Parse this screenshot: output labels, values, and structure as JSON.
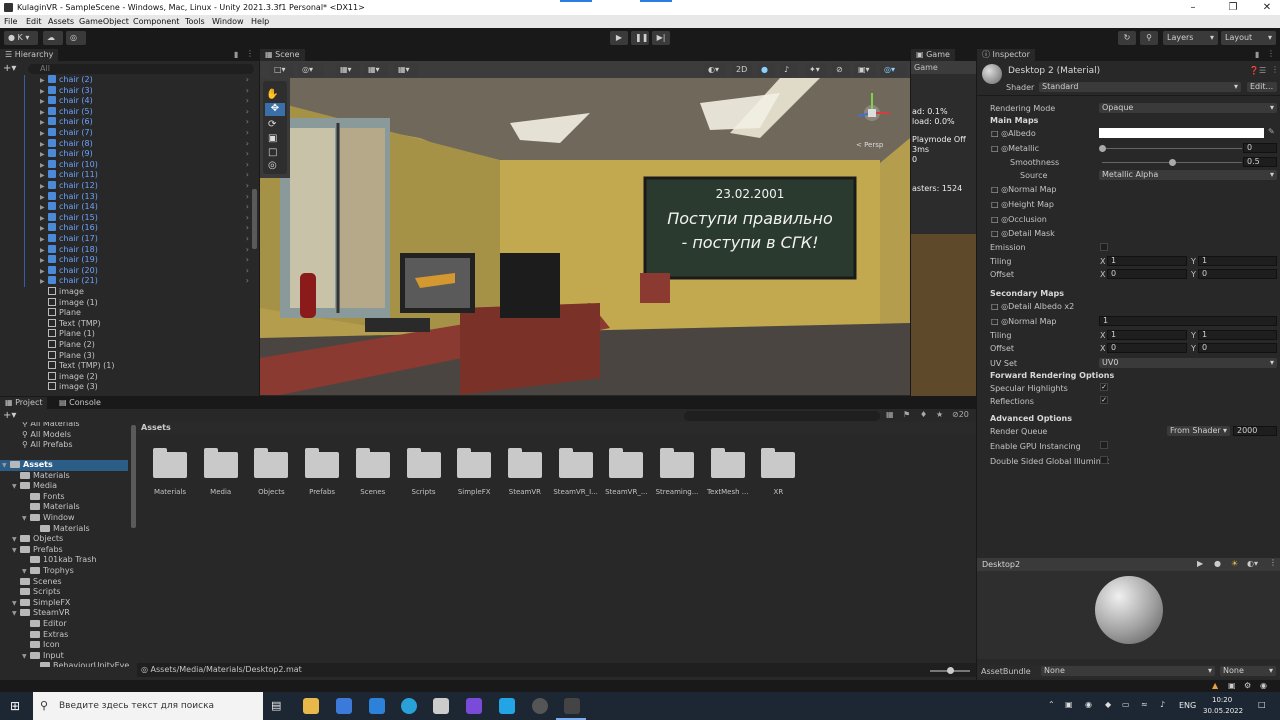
{
  "window": {
    "title": "KulaginVR - SampleScene - Windows, Mac, Linux - Unity 2021.3.3f1 Personal* <DX11>"
  },
  "menu": [
    "File",
    "Edit",
    "Assets",
    "GameObject",
    "Component",
    "Tools",
    "Window",
    "Help"
  ],
  "toolbar": {
    "account": "K",
    "layers": "Layers",
    "layout": "Layout"
  },
  "hierarchy": {
    "tab": "Hierarchy",
    "search_placeholder": "All",
    "chairs": [
      "chair (2)",
      "chair (3)",
      "chair (4)",
      "chair (5)",
      "chair (6)",
      "chair (7)",
      "chair (8)",
      "chair (9)",
      "chair (10)",
      "chair (11)",
      "chair (12)",
      "chair (13)",
      "chair (14)",
      "chair (15)",
      "chair (16)",
      "chair (17)",
      "chair (18)",
      "chair (19)",
      "chair (20)",
      "chair (21)"
    ],
    "others": [
      "image",
      "image (1)",
      "Plane",
      "Text (TMP)",
      "Plane (1)",
      "Plane (2)",
      "Plane (3)",
      "Text (TMP) (1)",
      "image (2)",
      "image (3)"
    ]
  },
  "scene": {
    "tab": "Scene",
    "mode_2d": "2D",
    "persp": "< Persp",
    "board_date": "23.02.2001",
    "board_line1": "Поступи правильно",
    "board_line2": "- поступи в СГК!"
  },
  "game": {
    "tab": "Game",
    "dropdown": "Game",
    "stats": [
      "ad: 0.1%",
      "load: 0.0%",
      "Playmode Off",
      "3ms",
      "0",
      "asters: 1524"
    ]
  },
  "project": {
    "tab_project": "Project",
    "tab_console": "Console",
    "breadcrumb": "Assets",
    "hidden_count": "20",
    "favorites": [
      "All Materials",
      "All Models",
      "All Prefabs"
    ],
    "tree": [
      "Assets",
      "Materials",
      "Media",
      "Fonts",
      "Materials",
      "Window",
      "Materials",
      "Objects",
      "Prefabs",
      "101kab Trash",
      "Trophys",
      "Scenes",
      "Scripts",
      "SimpleFX",
      "SteamVR",
      "Editor",
      "Extras",
      "Icon",
      "Input",
      "BehaviourUnityEvent",
      "Editor"
    ],
    "folders": [
      "Materials",
      "Media",
      "Objects",
      "Prefabs",
      "Scenes",
      "Scripts",
      "SimpleFX",
      "SteamVR",
      "SteamVR_I...",
      "SteamVR_...",
      "Streaming...",
      "TextMesh ...",
      "XR"
    ],
    "status_path": "Assets/Media/Materials/Desktop2.mat"
  },
  "inspector": {
    "tab": "Inspector",
    "material_name": "Desktop 2 (Material)",
    "shader_label": "Shader",
    "shader_value": "Standard",
    "edit_button": "Edit...",
    "rendering_mode_label": "Rendering Mode",
    "rendering_mode_value": "Opaque",
    "main_maps": "Main Maps",
    "albedo": "Albedo",
    "metallic": "Metallic",
    "metallic_value": "0",
    "smoothness": "Smoothness",
    "smoothness_value": "0.5",
    "smoothness_level": 0.5,
    "source": "Source",
    "source_value": "Metallic Alpha",
    "normal_map": "Normal Map",
    "height_map": "Height Map",
    "occlusion": "Occlusion",
    "detail_mask": "Detail Mask",
    "emission": "Emission",
    "tiling": "Tiling",
    "offset": "Offset",
    "tiling_x": "1",
    "tiling_y": "1",
    "offset_x": "0",
    "offset_y": "0",
    "x": "X",
    "y": "Y",
    "secondary_maps": "Secondary Maps",
    "detail_albedo": "Detail Albedo x2",
    "normal_map2": "Normal Map",
    "normal_map2_value": "1",
    "tiling2_x": "1",
    "tiling2_y": "1",
    "offset2_x": "0",
    "offset2_y": "0",
    "uv_set": "UV Set",
    "uv_set_value": "UV0",
    "forward_options": "Forward Rendering Options",
    "specular_highlights": "Specular Highlights",
    "reflections": "Reflections",
    "advanced_options": "Advanced Options",
    "render_queue": "Render Queue",
    "render_queue_source": "From Shader",
    "render_queue_value": "2000",
    "gpu_instancing": "Enable GPU Instancing",
    "double_sided": "Double Sided Global Illuminat",
    "preview_title": "Desktop2",
    "asset_bundle_label": "AssetBundle",
    "asset_bundle_value": "None",
    "asset_bundle_variant": "None"
  },
  "taskbar": {
    "search_placeholder": "Введите здесь текст для поиска",
    "lang": "ENG",
    "time": "10:20",
    "date": "30.05.2022"
  },
  "colors": {
    "accent": "#2c5d87",
    "selection": "#2c5d87",
    "board": "#2a3a2e"
  }
}
